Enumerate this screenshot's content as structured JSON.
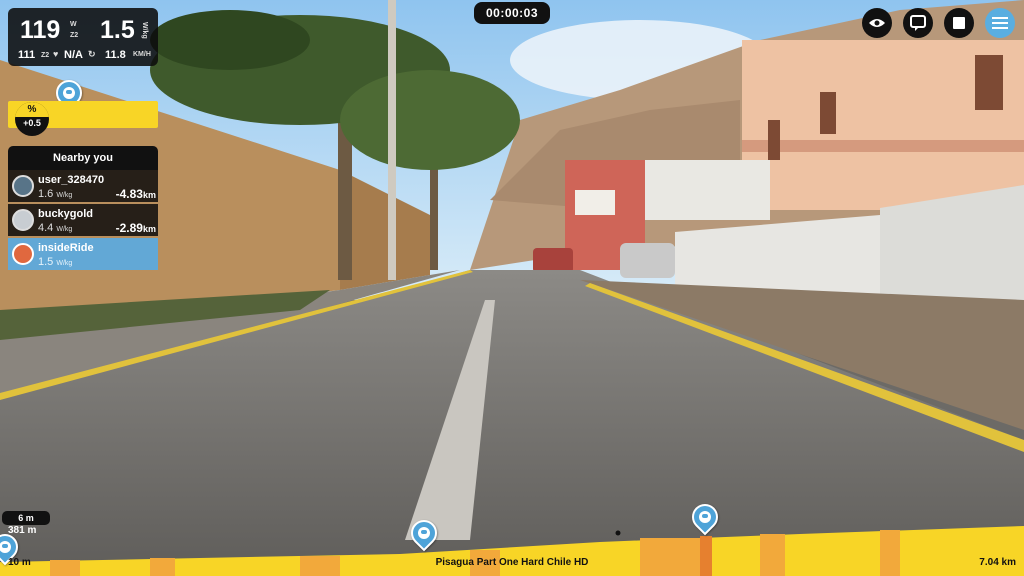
{
  "timer": "00:00:03",
  "stats": {
    "power": "119",
    "power_unit": "W",
    "zone": "Z2",
    "wkg": "1.5",
    "wkg_unit": "W/kg",
    "heart_rate": "111",
    "hr_zone": "Z2",
    "cadence": "N/A",
    "speed": "11.8",
    "speed_unit": "KM/H"
  },
  "grade": {
    "symbol": "%",
    "value": "+0.5"
  },
  "nearby": {
    "title": "Nearby you",
    "riders": [
      {
        "name": "user_328470",
        "wkg": "1.6",
        "unit": "W/kg",
        "gap": "-4.83",
        "gap_unit": "km"
      },
      {
        "name": "buckygold",
        "wkg": "4.4",
        "unit": "W/kg",
        "gap": "-2.89",
        "gap_unit": "km"
      },
      {
        "name": "insideRide",
        "wkg": "1.5",
        "unit": "W/kg",
        "gap": "",
        "gap_unit": ""
      }
    ]
  },
  "top_buttons": [
    {
      "icon": "eye-icon"
    },
    {
      "icon": "chat-icon"
    },
    {
      "icon": "stop-icon"
    },
    {
      "icon": "menu-icon"
    }
  ],
  "elevation": {
    "distance_badge": "6 m",
    "altitude": "381 m",
    "start_label": "10 m",
    "route_name": "Pisagua Part One Hard Chile HD",
    "total_distance": "7.04 km"
  },
  "colors": {
    "accent": "#5aaee0",
    "grade_yellow": "#f8d526",
    "panel": "#111111"
  }
}
